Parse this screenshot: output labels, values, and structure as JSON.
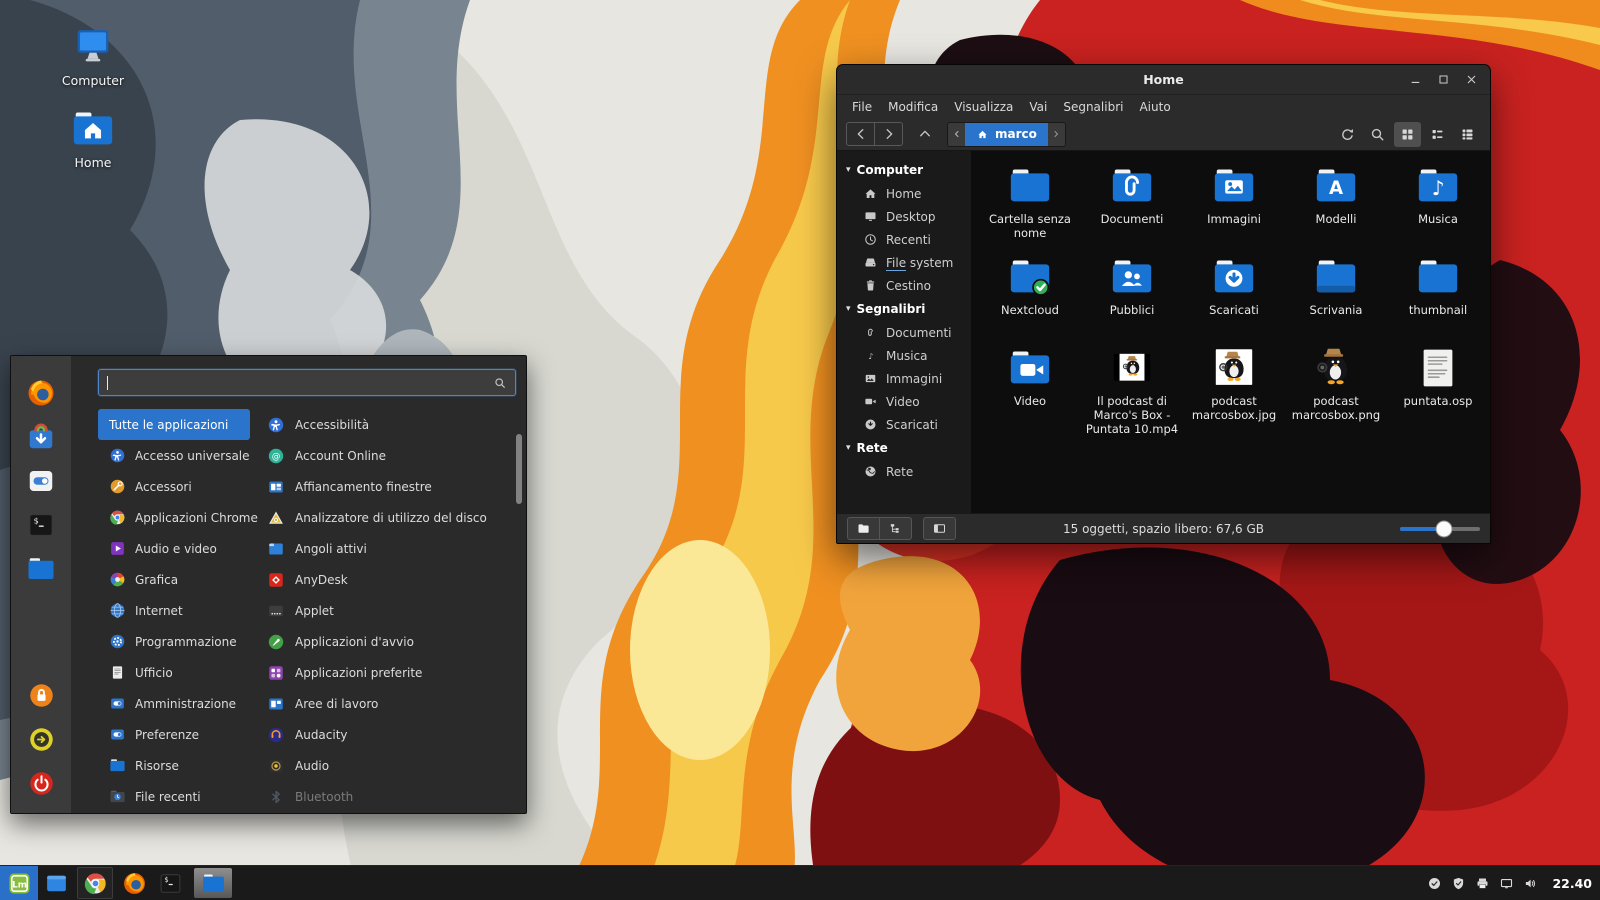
{
  "desktop": {
    "icons": [
      {
        "label": "Computer",
        "icon": "desk-computer"
      },
      {
        "label": "Home",
        "icon": "desk-home"
      }
    ]
  },
  "menu": {
    "search": {
      "value": "",
      "placeholder": "",
      "icon": "tb-search"
    },
    "favorites": [
      {
        "name": "firefox",
        "icon": "f-firefox"
      },
      {
        "name": "software-manager",
        "icon": "f-software"
      },
      {
        "name": "system-settings",
        "icon": "f-settings"
      },
      {
        "name": "terminal",
        "icon": "f-terminal"
      },
      {
        "name": "files",
        "icon": "f-files"
      }
    ],
    "session": [
      {
        "name": "lock-screen",
        "icon": "s-lock"
      },
      {
        "name": "logout",
        "icon": "s-logout"
      },
      {
        "name": "shutdown",
        "icon": "s-shutdown"
      }
    ],
    "categories": [
      {
        "label": "Tutte le applicazioni",
        "icon": "",
        "selected": true
      },
      {
        "label": "Accesso universale",
        "icon": "m-accessibility"
      },
      {
        "label": "Accessori",
        "icon": "m-accessories"
      },
      {
        "label": "Applicazioni Chrome",
        "icon": "m-chrome"
      },
      {
        "label": "Audio e video",
        "icon": "m-audiovideo"
      },
      {
        "label": "Grafica",
        "icon": "m-graphics"
      },
      {
        "label": "Internet",
        "icon": "m-internet"
      },
      {
        "label": "Programmazione",
        "icon": "m-programming"
      },
      {
        "label": "Ufficio",
        "icon": "m-office"
      },
      {
        "label": "Amministrazione",
        "icon": "m-admin"
      },
      {
        "label": "Preferenze",
        "icon": "m-prefs"
      },
      {
        "label": "Risorse",
        "icon": "m-resources"
      },
      {
        "label": "File recenti",
        "icon": "m-recent"
      }
    ],
    "apps": [
      {
        "label": "Accessibilità",
        "icon": "a-accessibility"
      },
      {
        "label": "Account Online",
        "icon": "a-account"
      },
      {
        "label": "Affiancamento finestre",
        "icon": "a-tiling"
      },
      {
        "label": "Analizzatore di utilizzo del disco",
        "icon": "a-disk"
      },
      {
        "label": "Angoli attivi",
        "icon": "a-corners"
      },
      {
        "label": "AnyDesk",
        "icon": "a-anydesk"
      },
      {
        "label": "Applet",
        "icon": "a-applet"
      },
      {
        "label": "Applicazioni d'avvio",
        "icon": "a-startup"
      },
      {
        "label": "Applicazioni preferite",
        "icon": "a-favapps"
      },
      {
        "label": "Aree di lavoro",
        "icon": "a-workspaces"
      },
      {
        "label": "Audacity",
        "icon": "a-audacity"
      },
      {
        "label": "Audio",
        "icon": "a-audio"
      },
      {
        "label": "Bluetooth",
        "icon": "a-bluetooth",
        "disabled": true
      }
    ]
  },
  "window": {
    "title": "Home",
    "controls": [
      {
        "name": "minimize",
        "icon": "wc-min"
      },
      {
        "name": "maximize",
        "icon": "wc-max"
      },
      {
        "name": "close",
        "icon": "wc-close"
      }
    ],
    "menubar": [
      {
        "label": "File"
      },
      {
        "label": "Modifica"
      },
      {
        "label": "Visualizza"
      },
      {
        "label": "Vai"
      },
      {
        "label": "Segnalibri"
      },
      {
        "label": "Aiuto"
      }
    ],
    "toolbar": {
      "nav": [
        {
          "name": "back",
          "icon": "tb-back"
        },
        {
          "name": "forward",
          "icon": "tb-forward"
        }
      ],
      "up": {
        "name": "up",
        "icon": "tb-up"
      },
      "breadcrumb": {
        "current": "marco",
        "icon": "tb-home-small"
      },
      "actions": [
        {
          "name": "reload",
          "icon": "tb-refresh"
        },
        {
          "name": "search",
          "icon": "tb-search"
        },
        {
          "name": "icon-view",
          "icon": "tb-grid",
          "active": true
        },
        {
          "name": "list-view",
          "icon": "tb-list"
        },
        {
          "name": "compact-view",
          "icon": "tb-compact"
        }
      ]
    },
    "sidebar": [
      {
        "section": "Computer",
        "items": [
          {
            "label": "Home",
            "icon": "sb-home"
          },
          {
            "label": "Desktop",
            "icon": "sb-desktop"
          },
          {
            "label": "Recenti",
            "icon": "sb-recent"
          },
          {
            "label": "File system",
            "icon": "sb-filesystem",
            "underline": true
          },
          {
            "label": "Cestino",
            "icon": "sb-trash"
          }
        ]
      },
      {
        "section": "Segnalibri",
        "items": [
          {
            "label": "Documenti",
            "icon": "sb-documents"
          },
          {
            "label": "Musica",
            "icon": "sb-music"
          },
          {
            "label": "Immagini",
            "icon": "sb-images"
          },
          {
            "label": "Video",
            "icon": "sb-videos"
          },
          {
            "label": "Scaricati",
            "icon": "sb-downloads"
          }
        ]
      },
      {
        "section": "Rete",
        "items": [
          {
            "label": "Rete",
            "icon": "sb-network"
          }
        ]
      }
    ],
    "files": [
      {
        "name": "Cartella senza nome",
        "icon": "folder-plain"
      },
      {
        "name": "Documenti",
        "icon": "folder-documents"
      },
      {
        "name": "Immagini",
        "icon": "folder-pictures"
      },
      {
        "name": "Modelli",
        "icon": "folder-templates"
      },
      {
        "name": "Musica",
        "icon": "folder-music"
      },
      {
        "name": "Nextcloud",
        "icon": "folder-nextcloud"
      },
      {
        "name": "Pubblici",
        "icon": "folder-public"
      },
      {
        "name": "Scaricati",
        "icon": "folder-downloads"
      },
      {
        "name": "Scrivania",
        "icon": "folder-desktop"
      },
      {
        "name": "thumbnail",
        "icon": "folder-plain"
      },
      {
        "name": "Video",
        "icon": "folder-videos"
      },
      {
        "name": "Il podcast di Marco's Box - Puntata 10.mp4",
        "icon": "file-video-thumb"
      },
      {
        "name": "podcast marcosbox.jpg",
        "icon": "file-image-jpg"
      },
      {
        "name": "podcast marcosbox.png",
        "icon": "file-image-png"
      },
      {
        "name": "puntata.osp",
        "icon": "file-document"
      }
    ],
    "status": {
      "text": "15 oggetti, spazio libero: 67,6 GB",
      "zoom_percent": 55,
      "buttons": [
        {
          "name": "places-toggle",
          "icon": "st-places"
        },
        {
          "name": "treeview-toggle",
          "icon": "st-tree"
        },
        {
          "name": "sidebar-toggle",
          "icon": "st-panel"
        }
      ]
    }
  },
  "taskbar": {
    "launchers": [
      {
        "name": "menu",
        "icon": "t-mint",
        "open": true
      },
      {
        "name": "show-desktop",
        "icon": "t-showdesk"
      },
      {
        "name": "chrome",
        "icon": "t-chrome",
        "framed": true
      },
      {
        "name": "firefox",
        "icon": "t-firefox"
      },
      {
        "name": "terminal",
        "icon": "t-terminal"
      },
      {
        "name": "files",
        "icon": "t-files",
        "active_window": true
      }
    ],
    "tray": [
      {
        "name": "updates",
        "icon": "y-check"
      },
      {
        "name": "firewall",
        "icon": "y-shield"
      },
      {
        "name": "printers",
        "icon": "y-printer"
      },
      {
        "name": "display",
        "icon": "y-display"
      },
      {
        "name": "volume",
        "icon": "y-volume"
      }
    ],
    "clock": "22.40"
  },
  "colors": {
    "accent_blue": "#2a74cc",
    "folder_blue": "#1973d2",
    "mint_green": "#87be3f",
    "wall_red": "#c92220",
    "wall_orange": "#ef9021",
    "wall_yellow": "#f7c94b",
    "wall_slate": "#515d6a"
  }
}
